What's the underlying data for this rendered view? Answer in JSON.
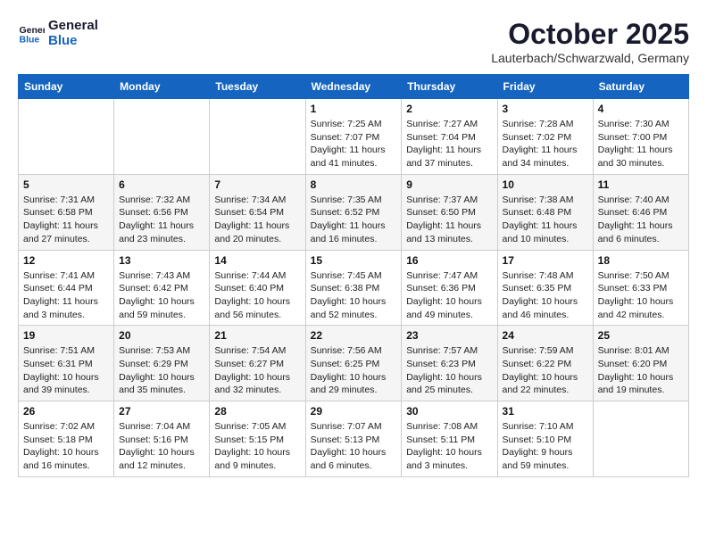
{
  "logo": {
    "line1": "General",
    "line2": "Blue"
  },
  "title": "October 2025",
  "subtitle": "Lauterbach/Schwarzwald, Germany",
  "days_header": [
    "Sunday",
    "Monday",
    "Tuesday",
    "Wednesday",
    "Thursday",
    "Friday",
    "Saturday"
  ],
  "weeks": [
    [
      {
        "num": "",
        "info": ""
      },
      {
        "num": "",
        "info": ""
      },
      {
        "num": "",
        "info": ""
      },
      {
        "num": "1",
        "info": "Sunrise: 7:25 AM\nSunset: 7:07 PM\nDaylight: 11 hours\nand 41 minutes."
      },
      {
        "num": "2",
        "info": "Sunrise: 7:27 AM\nSunset: 7:04 PM\nDaylight: 11 hours\nand 37 minutes."
      },
      {
        "num": "3",
        "info": "Sunrise: 7:28 AM\nSunset: 7:02 PM\nDaylight: 11 hours\nand 34 minutes."
      },
      {
        "num": "4",
        "info": "Sunrise: 7:30 AM\nSunset: 7:00 PM\nDaylight: 11 hours\nand 30 minutes."
      }
    ],
    [
      {
        "num": "5",
        "info": "Sunrise: 7:31 AM\nSunset: 6:58 PM\nDaylight: 11 hours\nand 27 minutes."
      },
      {
        "num": "6",
        "info": "Sunrise: 7:32 AM\nSunset: 6:56 PM\nDaylight: 11 hours\nand 23 minutes."
      },
      {
        "num": "7",
        "info": "Sunrise: 7:34 AM\nSunset: 6:54 PM\nDaylight: 11 hours\nand 20 minutes."
      },
      {
        "num": "8",
        "info": "Sunrise: 7:35 AM\nSunset: 6:52 PM\nDaylight: 11 hours\nand 16 minutes."
      },
      {
        "num": "9",
        "info": "Sunrise: 7:37 AM\nSunset: 6:50 PM\nDaylight: 11 hours\nand 13 minutes."
      },
      {
        "num": "10",
        "info": "Sunrise: 7:38 AM\nSunset: 6:48 PM\nDaylight: 11 hours\nand 10 minutes."
      },
      {
        "num": "11",
        "info": "Sunrise: 7:40 AM\nSunset: 6:46 PM\nDaylight: 11 hours\nand 6 minutes."
      }
    ],
    [
      {
        "num": "12",
        "info": "Sunrise: 7:41 AM\nSunset: 6:44 PM\nDaylight: 11 hours\nand 3 minutes."
      },
      {
        "num": "13",
        "info": "Sunrise: 7:43 AM\nSunset: 6:42 PM\nDaylight: 10 hours\nand 59 minutes."
      },
      {
        "num": "14",
        "info": "Sunrise: 7:44 AM\nSunset: 6:40 PM\nDaylight: 10 hours\nand 56 minutes."
      },
      {
        "num": "15",
        "info": "Sunrise: 7:45 AM\nSunset: 6:38 PM\nDaylight: 10 hours\nand 52 minutes."
      },
      {
        "num": "16",
        "info": "Sunrise: 7:47 AM\nSunset: 6:36 PM\nDaylight: 10 hours\nand 49 minutes."
      },
      {
        "num": "17",
        "info": "Sunrise: 7:48 AM\nSunset: 6:35 PM\nDaylight: 10 hours\nand 46 minutes."
      },
      {
        "num": "18",
        "info": "Sunrise: 7:50 AM\nSunset: 6:33 PM\nDaylight: 10 hours\nand 42 minutes."
      }
    ],
    [
      {
        "num": "19",
        "info": "Sunrise: 7:51 AM\nSunset: 6:31 PM\nDaylight: 10 hours\nand 39 minutes."
      },
      {
        "num": "20",
        "info": "Sunrise: 7:53 AM\nSunset: 6:29 PM\nDaylight: 10 hours\nand 35 minutes."
      },
      {
        "num": "21",
        "info": "Sunrise: 7:54 AM\nSunset: 6:27 PM\nDaylight: 10 hours\nand 32 minutes."
      },
      {
        "num": "22",
        "info": "Sunrise: 7:56 AM\nSunset: 6:25 PM\nDaylight: 10 hours\nand 29 minutes."
      },
      {
        "num": "23",
        "info": "Sunrise: 7:57 AM\nSunset: 6:23 PM\nDaylight: 10 hours\nand 25 minutes."
      },
      {
        "num": "24",
        "info": "Sunrise: 7:59 AM\nSunset: 6:22 PM\nDaylight: 10 hours\nand 22 minutes."
      },
      {
        "num": "25",
        "info": "Sunrise: 8:01 AM\nSunset: 6:20 PM\nDaylight: 10 hours\nand 19 minutes."
      }
    ],
    [
      {
        "num": "26",
        "info": "Sunrise: 7:02 AM\nSunset: 5:18 PM\nDaylight: 10 hours\nand 16 minutes."
      },
      {
        "num": "27",
        "info": "Sunrise: 7:04 AM\nSunset: 5:16 PM\nDaylight: 10 hours\nand 12 minutes."
      },
      {
        "num": "28",
        "info": "Sunrise: 7:05 AM\nSunset: 5:15 PM\nDaylight: 10 hours\nand 9 minutes."
      },
      {
        "num": "29",
        "info": "Sunrise: 7:07 AM\nSunset: 5:13 PM\nDaylight: 10 hours\nand 6 minutes."
      },
      {
        "num": "30",
        "info": "Sunrise: 7:08 AM\nSunset: 5:11 PM\nDaylight: 10 hours\nand 3 minutes."
      },
      {
        "num": "31",
        "info": "Sunrise: 7:10 AM\nSunset: 5:10 PM\nDaylight: 9 hours\nand 59 minutes."
      },
      {
        "num": "",
        "info": ""
      }
    ]
  ]
}
